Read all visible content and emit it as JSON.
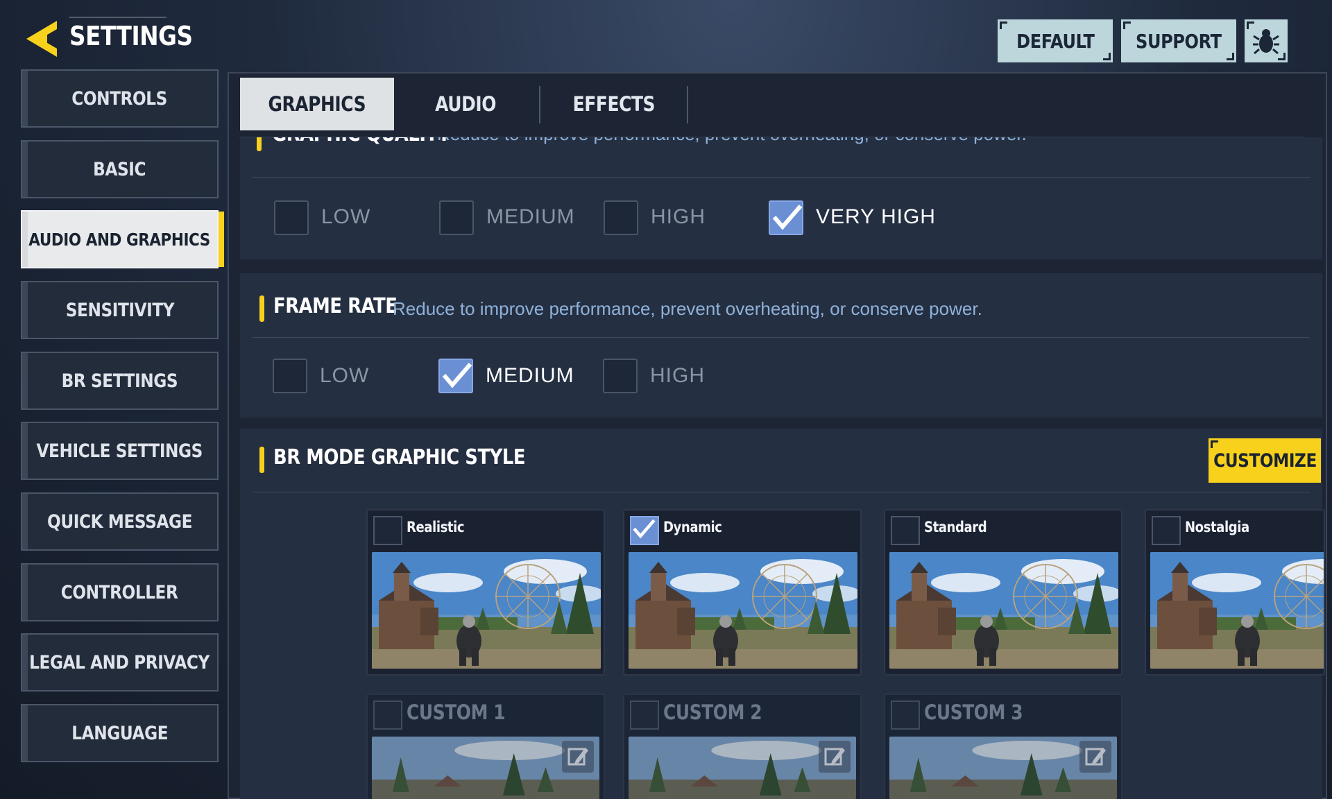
{
  "header": {
    "title": "SETTINGS",
    "buttons": {
      "default": "DEFAULT",
      "support": "SUPPORT"
    },
    "icons": {
      "back": "back-arrow-icon",
      "bug": "bug-icon"
    }
  },
  "colors": {
    "accent": "#f7d11c",
    "checkbox_checked": "#6a8fd3",
    "panel": "#1d2535"
  },
  "sidebar": {
    "items": [
      {
        "label": "CONTROLS",
        "active": false
      },
      {
        "label": "BASIC",
        "active": false
      },
      {
        "label": "AUDIO AND GRAPHICS",
        "active": true
      },
      {
        "label": "SENSITIVITY",
        "active": false
      },
      {
        "label": "BR SETTINGS",
        "active": false
      },
      {
        "label": "VEHICLE SETTINGS",
        "active": false
      },
      {
        "label": "QUICK MESSAGE",
        "active": false
      },
      {
        "label": "CONTROLLER",
        "active": false
      },
      {
        "label": "LEGAL AND PRIVACY",
        "active": false
      },
      {
        "label": "LANGUAGE",
        "active": false
      }
    ]
  },
  "tabs": [
    {
      "label": "GRAPHICS",
      "active": true
    },
    {
      "label": "AUDIO",
      "active": false
    },
    {
      "label": "EFFECTS",
      "active": false
    }
  ],
  "graphic_quality": {
    "title": "GRAPHIC QUALITY",
    "description": "Reduce to improve performance, prevent overheating, or conserve power.",
    "options": [
      {
        "label": "LOW",
        "checked": false
      },
      {
        "label": "MEDIUM",
        "checked": false
      },
      {
        "label": "HIGH",
        "checked": false
      },
      {
        "label": "VERY HIGH",
        "checked": true
      }
    ]
  },
  "frame_rate": {
    "title": "FRAME RATE",
    "description": "Reduce to improve performance, prevent overheating, or conserve power.",
    "options": [
      {
        "label": "LOW",
        "checked": false
      },
      {
        "label": "MEDIUM",
        "checked": true
      },
      {
        "label": "HIGH",
        "checked": false
      }
    ]
  },
  "br_mode_style": {
    "title": "BR MODE GRAPHIC STYLE",
    "customize_label": "CUSTOMIZE",
    "styles": [
      {
        "name": "Realistic",
        "checked": false
      },
      {
        "name": "Dynamic",
        "checked": true
      },
      {
        "name": "Standard",
        "checked": false
      },
      {
        "name": "Nostalgia",
        "checked": false
      }
    ],
    "customs": [
      {
        "name": "CUSTOM 1"
      },
      {
        "name": "CUSTOM 2"
      },
      {
        "name": "CUSTOM 3"
      }
    ],
    "edit_icon": "edit-icon"
  }
}
